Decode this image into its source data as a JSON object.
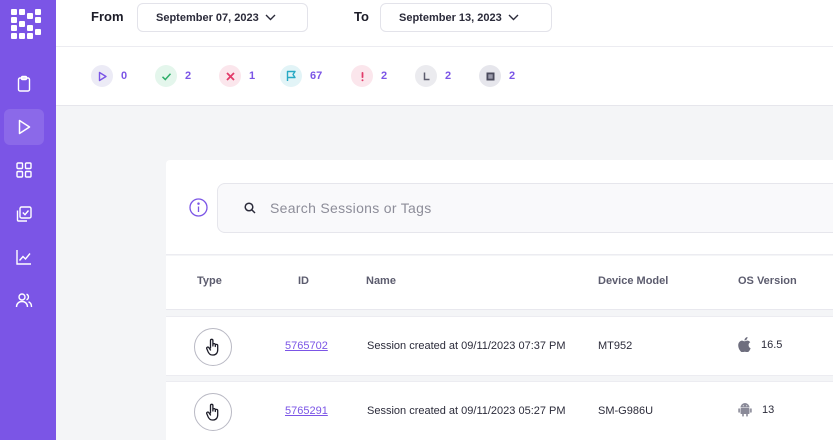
{
  "sidebar": {
    "logo_icon": "logo-grid-icon",
    "items": [
      {
        "name": "clipboard-icon",
        "active": false
      },
      {
        "name": "play-icon",
        "active": true
      },
      {
        "name": "grid-icon",
        "active": false
      },
      {
        "name": "check-copy-icon",
        "active": false
      },
      {
        "name": "chart-icon",
        "active": false
      },
      {
        "name": "users-icon",
        "active": false
      }
    ],
    "color": "#7b55e6"
  },
  "filters": {
    "from_label": "From",
    "from_value": "September 07, 2023",
    "to_label": "To",
    "to_value": "September 13, 2023"
  },
  "stats": [
    {
      "icon": "play-status-icon",
      "count": "0"
    },
    {
      "icon": "check-status-icon",
      "count": "2"
    },
    {
      "icon": "error-status-icon",
      "count": "1"
    },
    {
      "icon": "flag-status-icon",
      "count": "67"
    },
    {
      "icon": "warning-status-icon",
      "count": "2"
    },
    {
      "icon": "pending-status-icon",
      "count": "2"
    },
    {
      "icon": "stopped-status-icon",
      "count": "2"
    }
  ],
  "search": {
    "placeholder": "Search Sessions or Tags"
  },
  "table": {
    "columns": [
      "Type",
      "ID",
      "Name",
      "Device Model",
      "OS Version"
    ],
    "rows": [
      {
        "type_icon": "tap-icon",
        "id": "5765702",
        "name": "Session created at 09/11/2023 07:37 PM",
        "device": "MT952",
        "os_icon": "apple-icon",
        "os_version": "16.5"
      },
      {
        "type_icon": "tap-icon",
        "id": "5765291",
        "name": "Session created at 09/11/2023 05:27 PM",
        "device": "SM-G986U",
        "os_icon": "android-icon",
        "os_version": "13"
      }
    ]
  }
}
